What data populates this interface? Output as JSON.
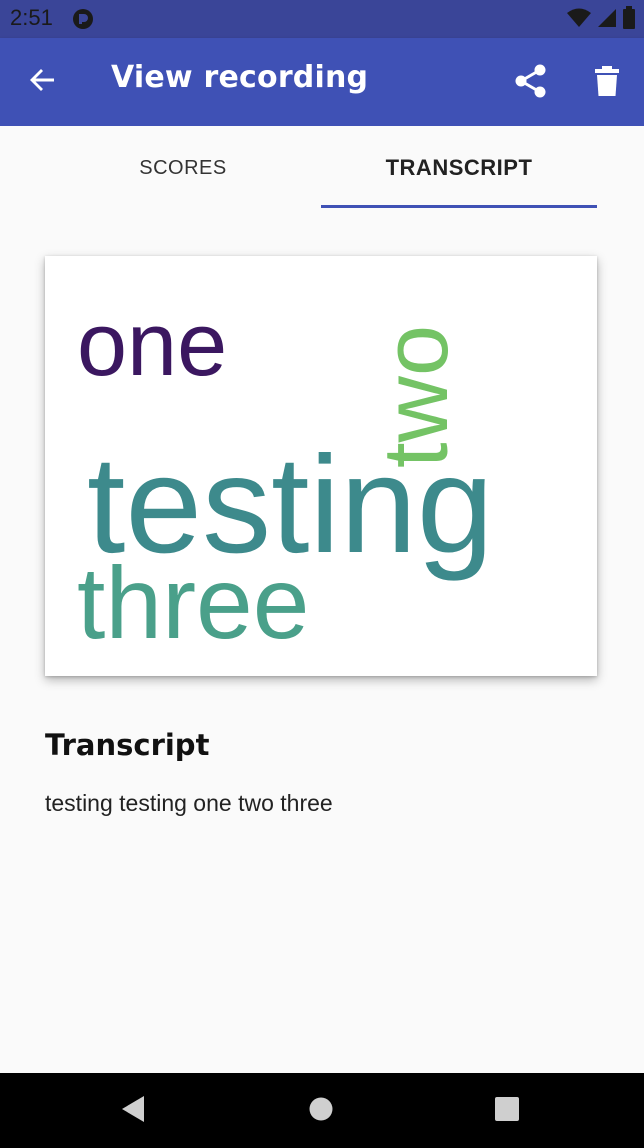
{
  "status_bar": {
    "time": "2:51",
    "icons": [
      "app-notification-icon",
      "wifi-icon",
      "signal-icon",
      "battery-icon"
    ]
  },
  "app_bar": {
    "title": "View recording",
    "back_icon": "arrow-back-icon",
    "share_icon": "share-icon",
    "delete_icon": "trash-icon",
    "color": "#3f51b5"
  },
  "tabs": [
    {
      "label": "SCORES",
      "selected": false
    },
    {
      "label": "TRANSCRIPT",
      "selected": true
    }
  ],
  "word_cloud": {
    "words": [
      {
        "text": "one",
        "color": "#3b1760"
      },
      {
        "text": "two",
        "color": "#74c365"
      },
      {
        "text": "testing",
        "color": "#3d8a8c"
      },
      {
        "text": "three",
        "color": "#4aa08a"
      }
    ]
  },
  "transcript": {
    "heading": "Transcript",
    "text": "testing testing one two three"
  },
  "nav_bar": {
    "icons": [
      "nav-back-icon",
      "nav-home-icon",
      "nav-recents-icon"
    ]
  }
}
